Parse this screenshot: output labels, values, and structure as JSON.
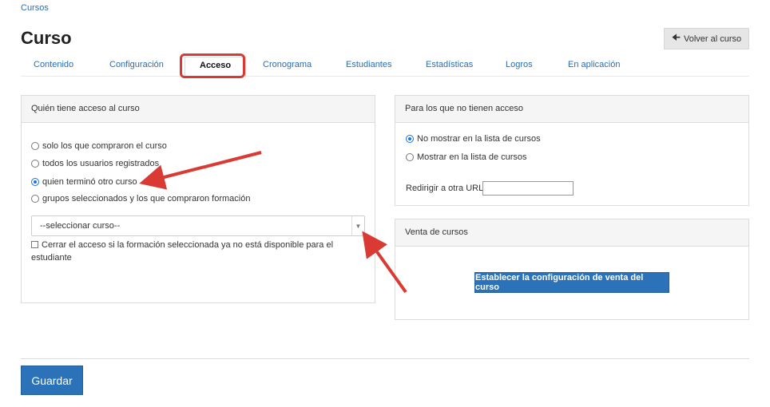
{
  "breadcrumb": "Cursos",
  "title": "Curso",
  "back_button": "Volver al curso",
  "tabs": [
    {
      "label": "Contenido"
    },
    {
      "label": "Configuración"
    },
    {
      "label": "Acceso"
    },
    {
      "label": "Cronograma"
    },
    {
      "label": "Estudiantes"
    },
    {
      "label": "Estadísticas"
    },
    {
      "label": "Logros"
    },
    {
      "label": "En aplicación"
    }
  ],
  "access_panel": {
    "title": "Quién tiene acceso al curso",
    "options": [
      {
        "label": "solo los que compraron el curso",
        "checked": false
      },
      {
        "label": "todos los usuarios registrados",
        "checked": false
      },
      {
        "label": "quien terminó otro curso",
        "checked": true
      },
      {
        "label": "grupos seleccionados y los que compraron formación",
        "checked": false
      }
    ],
    "select_value": "--seleccionar curso--",
    "checkbox_label": "Cerrar el acceso si la formación seleccionada ya no está disponible para el estudiante"
  },
  "no_access_panel": {
    "title": "Para los que no tienen acceso",
    "options": [
      {
        "label": "No mostrar en la lista de cursos",
        "checked": true
      },
      {
        "label": "Mostrar en la lista de cursos",
        "checked": false
      }
    ],
    "redirect_label": "Redirigir a otra URL",
    "redirect_value": ""
  },
  "sales_panel": {
    "title": "Venta de cursos",
    "button": "Establecer la configuración de venta del curso"
  },
  "save_button": "Guardar",
  "colors": {
    "link": "#2a6db3",
    "primary_button": "#2b72b8",
    "annotation": "#d93a33"
  }
}
